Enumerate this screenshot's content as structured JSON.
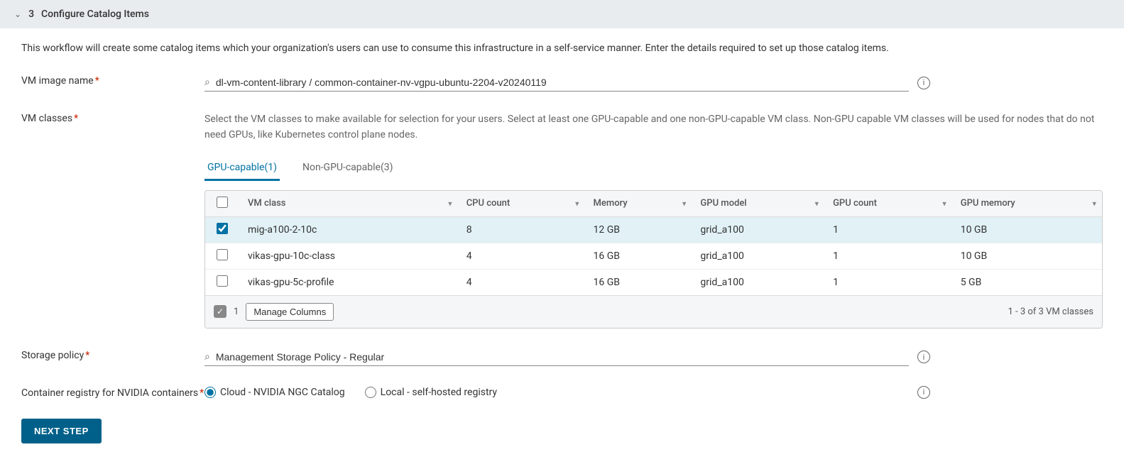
{
  "header": {
    "step_number": "3",
    "title": "Configure Catalog Items"
  },
  "description": "This workflow will create some catalog items which your organization's users can use to consume this infrastructure in a self-service manner. Enter the details required to set up those catalog items.",
  "vm_image": {
    "label": "VM image name",
    "value": "dl-vm-content-library / common-container-nv-vgpu-ubuntu-2204-v20240119"
  },
  "vm_classes": {
    "label": "VM classes",
    "help": "Select the VM classes to make available for selection for your users. Select at least one GPU-capable and one non-GPU-capable VM class. Non-GPU capable VM classes will be used for nodes that do not need GPUs, like Kubernetes control plane nodes.",
    "tabs": [
      {
        "label": "GPU-capable(1)",
        "active": true
      },
      {
        "label": "Non-GPU-capable(3)",
        "active": false
      }
    ],
    "columns": [
      "VM class",
      "CPU count",
      "Memory",
      "GPU model",
      "GPU count",
      "GPU memory"
    ],
    "rows": [
      {
        "selected": true,
        "vm_class": "mig-a100-2-10c",
        "cpu": "8",
        "memory": "12 GB",
        "gpu_model": "grid_a100",
        "gpu_count": "1",
        "gpu_memory": "10 GB"
      },
      {
        "selected": false,
        "vm_class": "vikas-gpu-10c-class",
        "cpu": "4",
        "memory": "16 GB",
        "gpu_model": "grid_a100",
        "gpu_count": "1",
        "gpu_memory": "10 GB"
      },
      {
        "selected": false,
        "vm_class": "vikas-gpu-5c-profile",
        "cpu": "4",
        "memory": "16 GB",
        "gpu_model": "grid_a100",
        "gpu_count": "1",
        "gpu_memory": "5 GB"
      }
    ],
    "footer": {
      "selected_count": "1",
      "manage_label": "Manage Columns",
      "range": "1 - 3 of 3 VM classes"
    }
  },
  "storage_policy": {
    "label": "Storage policy",
    "value": "Management Storage Policy - Regular"
  },
  "container_registry": {
    "label": "Container registry for NVIDIA containers",
    "options": [
      {
        "label": "Cloud - NVIDIA NGC Catalog",
        "checked": true
      },
      {
        "label": "Local - self-hosted registry",
        "checked": false
      }
    ]
  },
  "next_step_label": "NEXT STEP"
}
